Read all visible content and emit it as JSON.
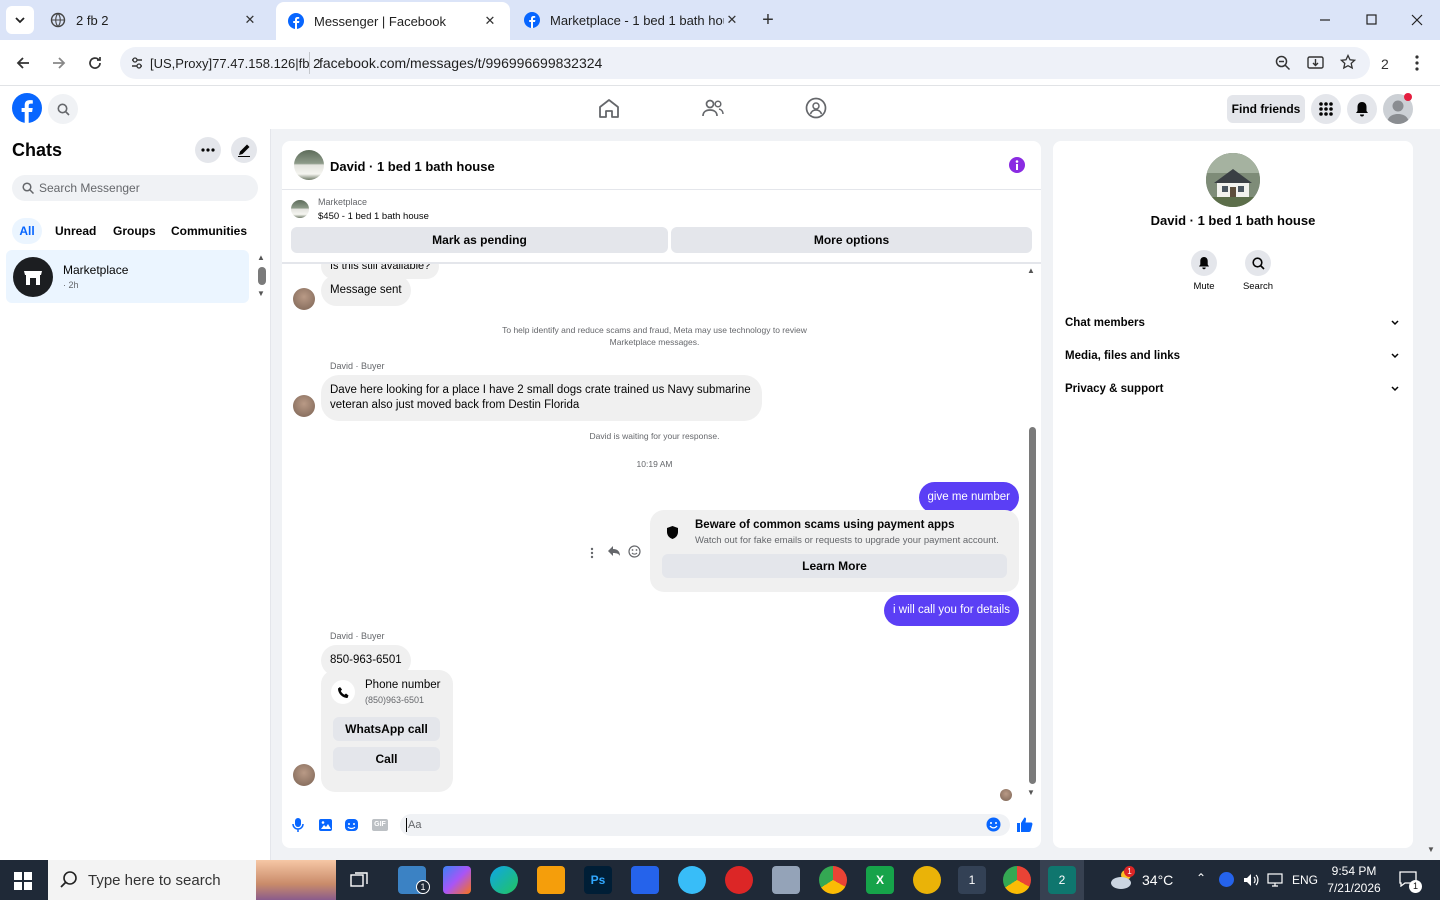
{
  "browser": {
    "tabs": [
      {
        "title": "2 fb 2"
      },
      {
        "title": "Messenger | Facebook"
      },
      {
        "title": "Marketplace - 1 bed 1 bath hou"
      }
    ],
    "proxy_label": "[US,Proxy]77.47.158.126|fb 2",
    "url": "facebook.com/messages/t/996996699832324",
    "profile_count": "2"
  },
  "fbnav": {
    "find_friends": "Find friends"
  },
  "sidebar": {
    "title": "Chats",
    "search_placeholder": "Search Messenger",
    "filters": [
      "All",
      "Unread",
      "Groups",
      "Communities"
    ],
    "chats": [
      {
        "name": "Marketplace",
        "meta": "· 2h"
      }
    ]
  },
  "chat": {
    "header_title": "David · 1 bed 1 bath house",
    "listing_source": "Marketplace",
    "listing_title": "$450 - 1 bed 1 bath house",
    "mark_pending": "Mark as pending",
    "more_options": "More options",
    "partial_message": "Is this still available?",
    "message_sent": "Message sent",
    "notice": "To help identify and reduce scams and fraud, Meta may use technology to review Marketplace messages.",
    "sender_label_1": "David · Buyer",
    "buyer_message": "Dave here looking for a place I have 2 small dogs crate trained us Navy submarine veteran also just moved back from Destin Florida",
    "waiting_notice": "David is waiting for your response.",
    "timestamp": "10:19 AM",
    "my_message_1": "give me number",
    "scam_title": "Beware of common scams using payment apps",
    "scam_body": "Watch out for fake emails or requests to upgrade your payment account.",
    "learn_more": "Learn More",
    "my_message_2": "i will call you for details",
    "sender_label_2": "David · Buyer",
    "phone_message": "850-963-6501",
    "phone_card_title": "Phone number",
    "phone_card_number": "(850)963-6501",
    "whatsapp_call": "WhatsApp call",
    "call": "Call",
    "composer_placeholder": "Aa"
  },
  "info": {
    "name": "David · 1 bed 1 bath house",
    "mute": "Mute",
    "search": "Search",
    "sections": [
      "Chat members",
      "Media, files and links",
      "Privacy & support"
    ]
  },
  "taskbar": {
    "search_placeholder": "Type here to search",
    "weather": "34°C",
    "language": "ENG",
    "time": "9:54 PM",
    "date": "7/21/2026",
    "mail_badge": "1",
    "notification_badge": "1",
    "weather_badge": "1"
  },
  "colors": {
    "fb_blue": "#0866ff",
    "my_bubble": "#5b3ff5",
    "info_purple": "#8a2be2"
  }
}
